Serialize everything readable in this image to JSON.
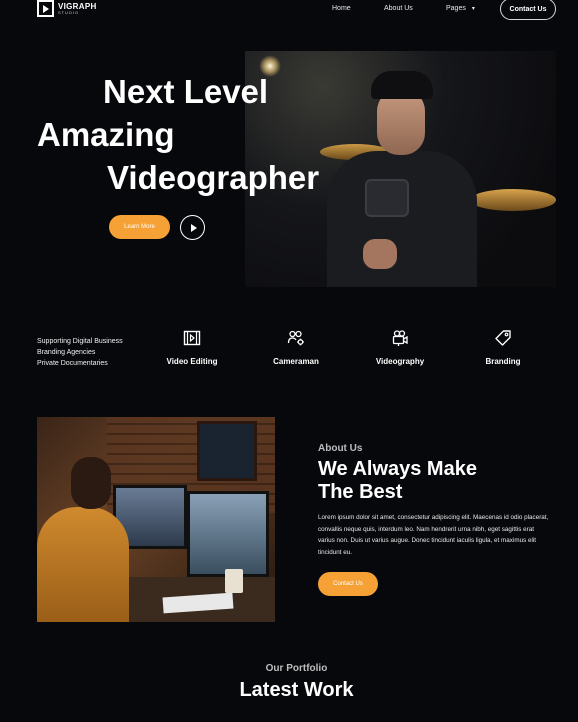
{
  "nav": {
    "logo_name": "VIGRAPH",
    "logo_sub": "STUDIO",
    "links": [
      "Home",
      "About Us",
      "Pages"
    ],
    "pages_chevron": "▾",
    "contact_label": "Contact Us"
  },
  "hero": {
    "title_line1": "Next Level",
    "title_line2": "Amazing",
    "title_line3": "Videographer",
    "cta_label": "Learn More",
    "accent_color": "#f6a136"
  },
  "features": {
    "side_list": [
      "Supporting Digital Business",
      "Branding Agencies",
      "Private Documentaries"
    ],
    "services": [
      {
        "label": "Video Editing",
        "icon": "film-icon"
      },
      {
        "label": "Cameraman",
        "icon": "people-gear-icon"
      },
      {
        "label": "Videography",
        "icon": "video-camera-icon"
      },
      {
        "label": "Branding",
        "icon": "tag-icon"
      }
    ]
  },
  "about": {
    "tag": "About Us",
    "title_line1": "We Always Make",
    "title_line2": "The Best",
    "body": "Lorem ipsum dolor sit amet, consectetur adipiscing elit. Maecenas id odio placerat, convallis neque quis, interdum leo. Nam hendrerit urna nibh, eget sagittis erat varius non. Duis ut varius augue. Donec tincidunt iaculis ligula, et maximus elit tincidunt eu.",
    "cta_label": "Contact Us"
  },
  "portfolio": {
    "tag": "Our Portfolio",
    "title": "Latest Work"
  }
}
